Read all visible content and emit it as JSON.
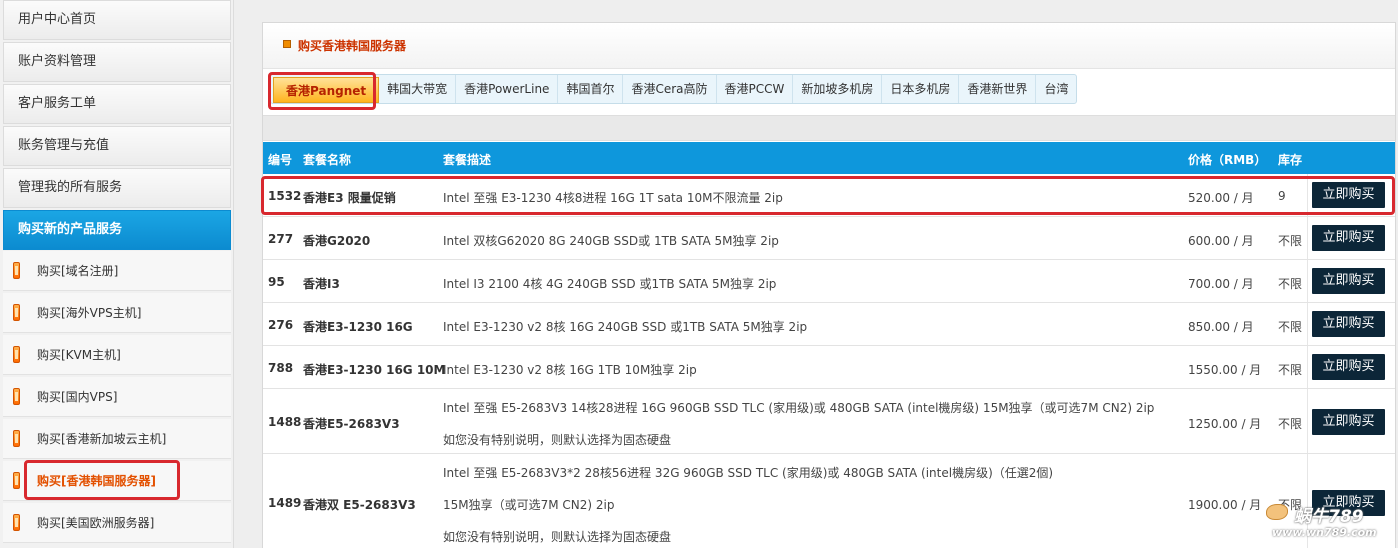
{
  "sidebar": {
    "items": [
      {
        "label": "用户中心首页"
      },
      {
        "label": "账户资料管理"
      },
      {
        "label": "客户服务工单"
      },
      {
        "label": "账务管理与充值"
      },
      {
        "label": "管理我的所有服务"
      },
      {
        "label": "购买新的产品服务"
      }
    ],
    "sub_items": [
      {
        "label": "购买[域名注册]"
      },
      {
        "label": "购买[海外VPS主机]"
      },
      {
        "label": "购买[KVM主机]"
      },
      {
        "label": "购买[国内VPS]"
      },
      {
        "label": "购买[香港新加坡云主机]"
      },
      {
        "label": "购买[香港韩国服务器]"
      },
      {
        "label": "购买[美国欧洲服务器]"
      }
    ]
  },
  "panel": {
    "title": "购买香港韩国服务器"
  },
  "tabs": [
    "香港Pangnet",
    "韩国大带宽",
    "香港PowerLine",
    "韩国首尔",
    "香港Cera高防",
    "香港PCCW",
    "新加坡多机房",
    "日本多机房",
    "香港新世界",
    "台湾"
  ],
  "table": {
    "headers": {
      "id": "编号",
      "name": "套餐名称",
      "desc": "套餐描述",
      "price": "价格（RMB）",
      "stock": "库存"
    },
    "buy_label": "立即购买",
    "rows": [
      {
        "id": "1532",
        "name": "香港E3 限量促销",
        "desc": [
          "Intel 至强 E3-1230 4核8进程 16G 1T  sata  10M不限流量 2ip"
        ],
        "price": "520.00 / 月",
        "stock": "9"
      },
      {
        "id": "277",
        "name": "香港G2020",
        "desc": [
          "Intel 双核G62020 8G 240GB SSD或 1TB SATA 5M独享 2ip"
        ],
        "price": "600.00 / 月",
        "stock": "不限"
      },
      {
        "id": "95",
        "name": "香港I3",
        "desc": [
          "Intel I3 2100 4核 4G 240GB SSD 或1TB SATA 5M独享 2ip"
        ],
        "price": "700.00 / 月",
        "stock": "不限"
      },
      {
        "id": "276",
        "name": "香港E3-1230 16G",
        "desc": [
          "Intel E3-1230 v2 8核 16G 240GB SSD 或1TB SATA 5M独享 2ip"
        ],
        "price": "850.00 / 月",
        "stock": "不限"
      },
      {
        "id": "788",
        "name": "香港E3-1230 16G 10M",
        "desc": [
          "Intel E3-1230 v2 8核 16G 1TB 10M独享 2ip"
        ],
        "price": "1550.00 / 月",
        "stock": "不限"
      },
      {
        "id": "1488",
        "name": "香港E5-2683V3",
        "desc": [
          "Intel 至强 E5-2683V3 14核28进程 16G 960GB SSD TLC (家用级)或 480GB SATA (intel機房级) 15M独享（或可选7M CN2)   2ip",
          "如您没有特别说明，则默认选择为固态硬盘"
        ],
        "price": "1250.00 / 月",
        "stock": "不限"
      },
      {
        "id": "1489",
        "name": "香港双 E5-2683V3",
        "desc": [
          "Intel 至强 E5-2683V3*2 28核56进程 32G 960GB SSD TLC (家用级)或 480GB SATA (intel機房级)（任選2個)",
          "15M独享（或可选7M CN2)   2ip",
          "如您没有特别说明，则默认选择为固态硬盘"
        ],
        "price": "1900.00 / 月",
        "stock": "不限"
      }
    ]
  },
  "watermark": {
    "logo": "蜗牛789",
    "url": "www.wn789.com"
  }
}
